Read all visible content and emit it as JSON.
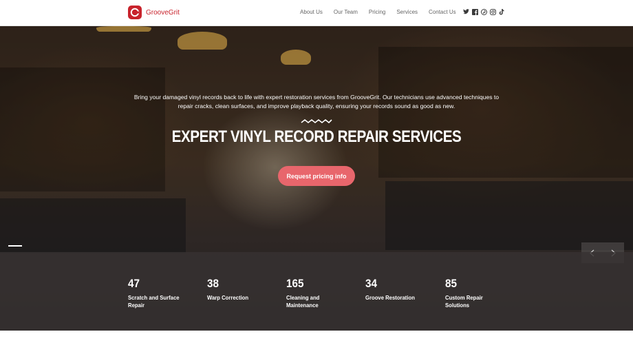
{
  "brand": {
    "name": "GrooveGrit",
    "color": "#c8232c"
  },
  "nav": {
    "links": [
      "About Us",
      "Our Team",
      "Pricing",
      "Services",
      "Contact Us"
    ],
    "social_icons": [
      "twitter-icon",
      "facebook-icon",
      "pinterest-icon",
      "instagram-icon",
      "tiktok-icon"
    ]
  },
  "hero": {
    "intro": "Bring your damaged vinyl records back to life with expert restoration services from GrooveGrit. Our technicians use advanced techniques to repair cracks, clean surfaces, and improve playback quality, ensuring your records sound as good as new.",
    "title": "EXPERT VINYL RECORD REPAIR SERVICES",
    "cta": "Request pricing info",
    "cta_color": "#e8666c"
  },
  "slider": {
    "prev_icon": "chevron-left-icon",
    "next_icon": "chevron-right-icon"
  },
  "stats": [
    {
      "value": "47",
      "label": "Scratch and Surface Repair"
    },
    {
      "value": "38",
      "label": "Warp Correction"
    },
    {
      "value": "165",
      "label": "Cleaning and Maintenance"
    },
    {
      "value": "34",
      "label": "Groove Restoration"
    },
    {
      "value": "85",
      "label": "Custom Repair Solutions"
    }
  ]
}
